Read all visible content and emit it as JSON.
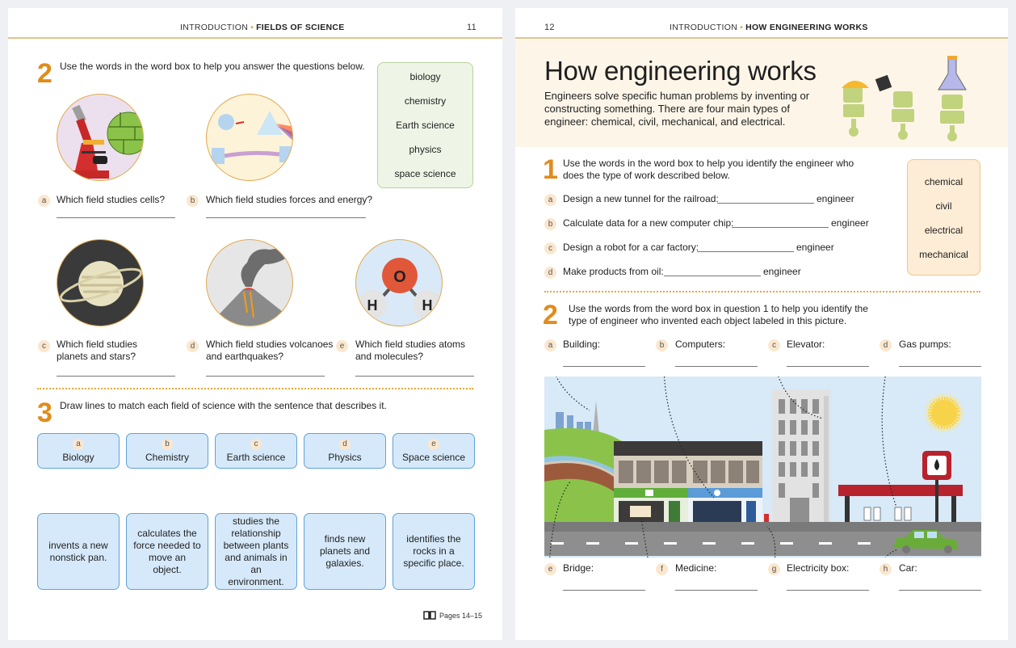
{
  "left_page": {
    "header": {
      "section": "INTRODUCTION",
      "topic": "FIELDS OF SCIENCE",
      "page_number": "11"
    },
    "exercise2": {
      "number": "2",
      "instruction": "Use the words in the word box to help you answer the questions below.",
      "word_box": [
        "biology",
        "chemistry",
        "Earth science",
        "physics",
        "space science"
      ],
      "questions": [
        {
          "letter": "a",
          "text": "Which field studies cells?",
          "illustration": "microscope-cells-icon"
        },
        {
          "letter": "b",
          "text": "Which field studies forces and energy?",
          "illustration": "prism-robots-icon"
        },
        {
          "letter": "c",
          "text": "Which field studies planets and stars?",
          "illustration": "saturn-icon"
        },
        {
          "letter": "d",
          "text": "Which field studies volcanoes and earthquakes?",
          "illustration": "volcano-icon"
        },
        {
          "letter": "e",
          "text": "Which field studies atoms and molecules?",
          "illustration": "water-molecule-icon"
        }
      ],
      "molecule_labels": {
        "center": "O",
        "left": "H",
        "right": "H"
      }
    },
    "exercise3": {
      "number": "3",
      "instruction": "Draw lines to match each field of science with the sentence that describes it.",
      "fields": [
        {
          "letter": "a",
          "label": "Biology"
        },
        {
          "letter": "b",
          "label": "Chemistry"
        },
        {
          "letter": "c",
          "label": "Earth science"
        },
        {
          "letter": "d",
          "label": "Physics"
        },
        {
          "letter": "e",
          "label": "Space science"
        }
      ],
      "descriptions": [
        "invents a new nonstick pan.",
        "calculates the force needed to move an object.",
        "studies the relationship between plants and animals in an environment.",
        "finds new planets and galaxies.",
        "identifies the rocks in a specific place."
      ]
    },
    "footer": {
      "icon": "book-icon",
      "text": "Pages 14–15"
    }
  },
  "right_page": {
    "header": {
      "section": "INTRODUCTION",
      "topic": "HOW ENGINEERING WORKS",
      "page_number": "12"
    },
    "title": "How engineering works",
    "intro": "Engineers solve specific human problems by inventing or constructing something. There are four main types of engineer: chemical, civil, mechanical, and electrical.",
    "exercise1": {
      "number": "1",
      "instruction": "Use the words in the word box to help you identify the engineer who does the type of work described below.",
      "word_box": [
        "chemical",
        "civil",
        "electrical",
        "mechanical"
      ],
      "items": [
        {
          "letter": "a",
          "text": "Design a new tunnel for the railroad:",
          "suffix": "engineer"
        },
        {
          "letter": "b",
          "text": "Calculate data for a new computer chip:",
          "suffix": "engineer"
        },
        {
          "letter": "c",
          "text": "Design a robot for a car factory:",
          "suffix": "engineer"
        },
        {
          "letter": "d",
          "text": "Make products from oil:",
          "suffix": "engineer"
        }
      ]
    },
    "exercise2": {
      "number": "2",
      "instruction": "Use the words from the word box in question 1 to help you identify the type of engineer who invented each object labeled in this picture.",
      "top_labels": [
        {
          "letter": "a",
          "text": "Building:"
        },
        {
          "letter": "b",
          "text": "Computers:"
        },
        {
          "letter": "c",
          "text": "Elevator:"
        },
        {
          "letter": "d",
          "text": "Gas pumps:"
        }
      ],
      "bottom_labels": [
        {
          "letter": "e",
          "text": "Bridge:"
        },
        {
          "letter": "f",
          "text": "Medicine:"
        },
        {
          "letter": "g",
          "text": "Electricity box:"
        },
        {
          "letter": "h",
          "text": "Car:"
        }
      ]
    }
  },
  "colors": {
    "accent_orange": "#e08c1c",
    "header_rule": "#e2c38a",
    "word_box_green": "#eef5e6",
    "word_box_peach": "#fdecd6",
    "match_blue": "#d6e9fa",
    "intro_bg": "#fdf5e8"
  }
}
